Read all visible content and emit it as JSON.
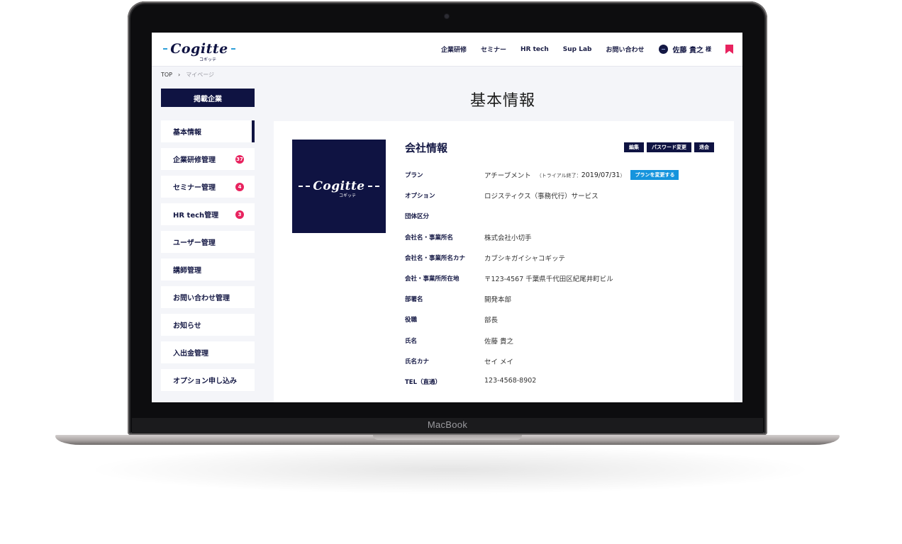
{
  "device": {
    "brand_label": "MacBook"
  },
  "header": {
    "logo_text": "Cogitte",
    "logo_sub": "コギッテ",
    "nav": [
      "企業研修",
      "セミナー",
      "HR tech",
      "Sup Lab",
      "お問い合わせ"
    ],
    "user_name": "佐藤 貴之",
    "user_suffix": "様"
  },
  "breadcrumb": {
    "top": "TOP",
    "separator": "›",
    "current": "マイページ"
  },
  "page_title": "基本情報",
  "sidebar": {
    "heading": "掲載企業",
    "items": [
      {
        "label": "基本情報",
        "badge": ""
      },
      {
        "label": "企業研修管理",
        "badge": "37"
      },
      {
        "label": "セミナー管理",
        "badge": "4"
      },
      {
        "label": "HR tech管理",
        "badge": "3"
      },
      {
        "label": "ユーザー管理",
        "badge": ""
      },
      {
        "label": "講師管理",
        "badge": ""
      },
      {
        "label": "お問い合わせ管理",
        "badge": ""
      },
      {
        "label": "お知らせ",
        "badge": ""
      },
      {
        "label": "入出金管理",
        "badge": ""
      },
      {
        "label": "オプション申し込み",
        "badge": ""
      }
    ]
  },
  "company": {
    "section_title": "会社情報",
    "actions": {
      "edit": "編集",
      "password": "パスワード変更",
      "withdraw": "退会"
    },
    "plan": {
      "label": "プラン",
      "value": "アチーブメント",
      "trial_prefix": "（トライアル終了：",
      "trial_date": "2019/07/31",
      "trial_suffix": "）",
      "change_button": "プランを変更する"
    },
    "rows": [
      {
        "label": "オプション",
        "value": "ロジスティクス（事務代行）サービス"
      },
      {
        "label": "団体区分",
        "value": ""
      },
      {
        "label": "会社名・事業所名",
        "value": "株式会社小切手"
      },
      {
        "label": "会社名・事業所名カナ",
        "value": "カブシキガイシャコギッテ"
      },
      {
        "label": "会社・事業所所在地",
        "value": "〒123-4567 千葉県千代田区紀尾井町ビル"
      },
      {
        "label": "部署名",
        "value": "開発本部"
      },
      {
        "label": "役職",
        "value": "部長"
      },
      {
        "label": "氏名",
        "value": "佐藤 貴之"
      },
      {
        "label": "氏名カナ",
        "value": "セイ メイ"
      },
      {
        "label": "TEL（直通）",
        "value": "123-4568-8902"
      }
    ]
  },
  "colors": {
    "navy": "#0f1342",
    "accent_pink": "#e8235f",
    "accent_blue": "#1594dd"
  }
}
